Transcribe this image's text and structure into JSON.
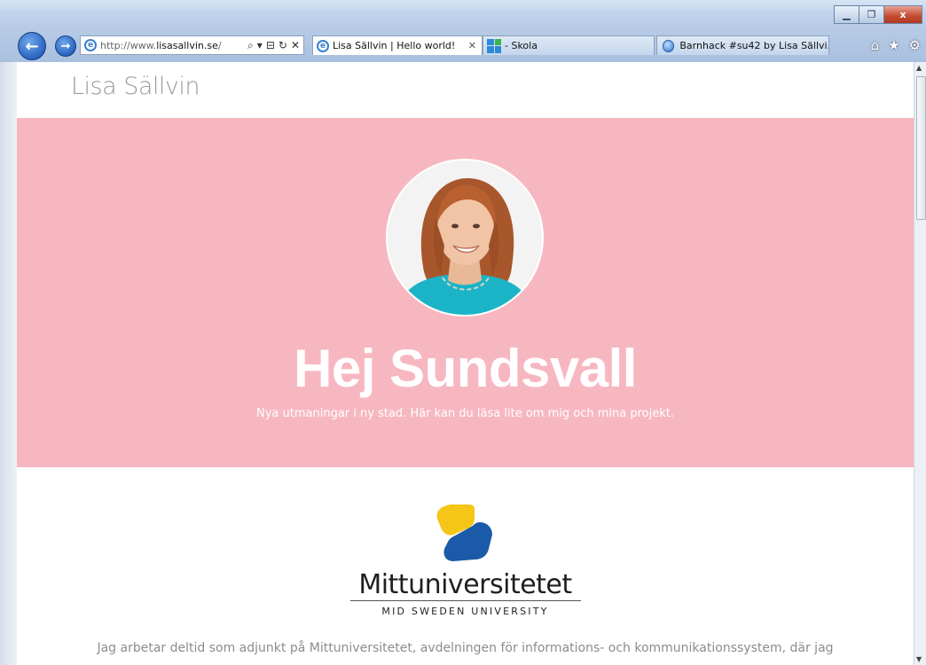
{
  "browser": {
    "address_url_prefix": "http://www.",
    "address_url_domain": "lisasallvin.se",
    "address_url_suffix": "/",
    "address_tools": {
      "search": "⌕",
      "dropdown": "▾",
      "compat": "⊟",
      "refresh": "↻",
      "stop": "✕"
    },
    "tabs": [
      {
        "label": "Lisa Sällvin | Hello world!",
        "close": "✕",
        "icon": "ie-page-icon"
      },
      {
        "label": "- Skola",
        "icon": "windows-grid-icon"
      },
      {
        "label": "Barnhack #su42 by Lisa Sällvi...",
        "icon": "globe-icon"
      }
    ],
    "window_controls": {
      "minimize": "▁",
      "maximize": "❐",
      "close": "x"
    },
    "toolbar_icons": {
      "home": "⌂",
      "favorites": "★",
      "tools": "⚙"
    },
    "nav": {
      "back": "←",
      "forward": "→"
    }
  },
  "site": {
    "title": "Lisa Sällvin"
  },
  "hero": {
    "heading": "Hej Sundsvall",
    "subtitle": "Nya utmaningar i ny stad. Här kan du läsa lite om mig och mina projekt.",
    "background": "#f7b7c1"
  },
  "university": {
    "name": "Mittuniversitetet",
    "subtitle": "MID SWEDEN UNIVERSITY",
    "logo_colors": {
      "yellow": "#f5c518",
      "blue": "#1a5aa8"
    }
  },
  "intro": {
    "text": "Jag arbetar deltid som adjunkt på Mittuniversitetet, avdelningen för informations- och kommunikationssystem, där jag"
  },
  "scrollbar": {
    "up": "▲",
    "down": "▼"
  }
}
